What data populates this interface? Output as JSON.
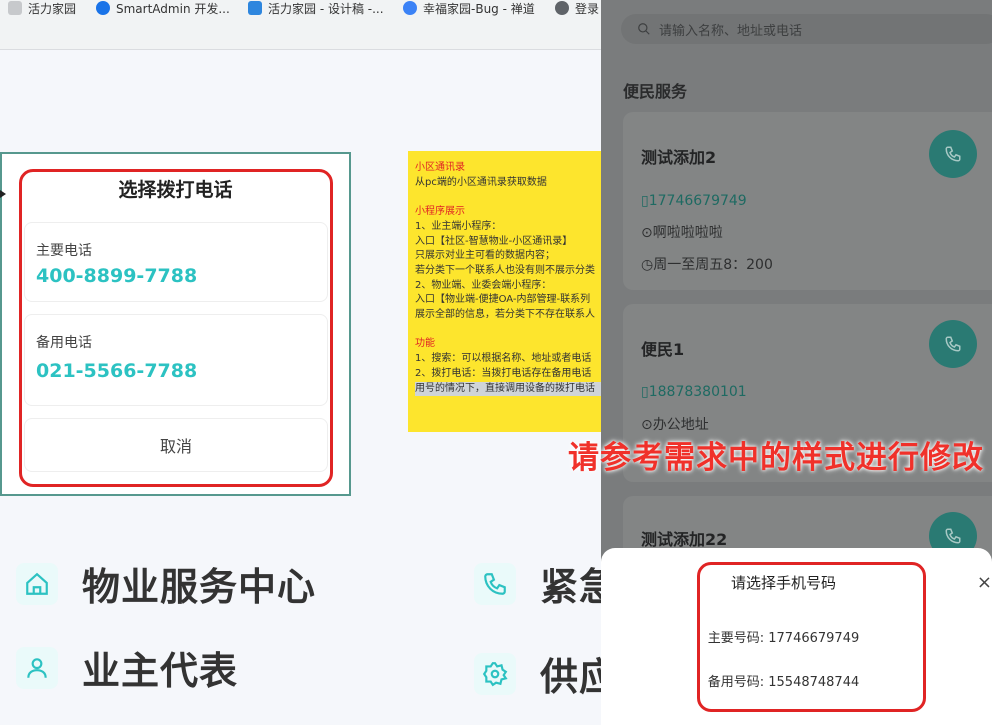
{
  "bookmarks": [
    {
      "label": "活力家园",
      "icon": "page-icon",
      "color": "#9aa0a6"
    },
    {
      "label": "SmartAdmin 开发...",
      "icon": "smartadmin-icon",
      "color": "#1a73e8"
    },
    {
      "label": "活力家园 - 设计稿 -...",
      "icon": "design-icon",
      "color": "#2e86de"
    },
    {
      "label": "幸福家园-Bug - 禅道",
      "icon": "zentao-icon",
      "color": "#3b82f6"
    },
    {
      "label": "登录",
      "icon": "globe-icon",
      "color": "#5f6368"
    }
  ],
  "mock_dialog": {
    "title": "选择拨打电话",
    "primary_label": "主要电话",
    "primary_number": "400-8899-7788",
    "backup_label": "备用电话",
    "backup_number": "021-5566-7788",
    "cancel": "取消"
  },
  "note": {
    "h1": "小区通讯录",
    "l1": "从pc端的小区通讯录获取数据",
    "h2": "小程序展示",
    "l2": "1、业主端小程序：",
    "l3": "入口【社区-智慧物业-小区通讯录】",
    "l4": "只展示对业主可看的数据内容；",
    "l5": "若分类下一个联系人也没有则不展示分类",
    "l6": "2、物业端、业委会端小程序：",
    "l7": "入口【物业端-便捷OA-内部管理-联系列",
    "l8": "展示全部的信息，若分类下不存在联系人",
    "h3": "功能",
    "l9": "1、搜索：可以根据名称、地址或者电话",
    "l10": "2、拨打电话：当拨打电话存在备用电话",
    "l11": "用号的情况下，直接调用设备的拨打电话"
  },
  "services": [
    {
      "label": "物业服务中心",
      "icon": "home-icon"
    },
    {
      "label": "紧急",
      "icon": "phone-icon"
    },
    {
      "label": "业主代表",
      "icon": "user-icon"
    },
    {
      "label": "供应",
      "icon": "gear-icon"
    }
  ],
  "phone": {
    "search_placeholder": "请输入名称、地址或电话",
    "section": "便民服务",
    "cards": [
      {
        "name": "测试添加2",
        "tel": "17746679749",
        "addr": "啊啦啦啦啦",
        "hours": "周一至周五8：200"
      },
      {
        "name": "便民1",
        "tel": "18878380101",
        "addr": "办公地址"
      },
      {
        "name": "测试添加22"
      }
    ],
    "sheet": {
      "title": "请选择手机号码",
      "primary": "主要号码: 17746679749",
      "backup": "备用号码: 15548748744",
      "close": "×"
    }
  },
  "annotation": "请参考需求中的样式进行修改",
  "colors": {
    "accent": "#2cc2c2",
    "alert": "#e02424",
    "note": "#fde52d"
  }
}
